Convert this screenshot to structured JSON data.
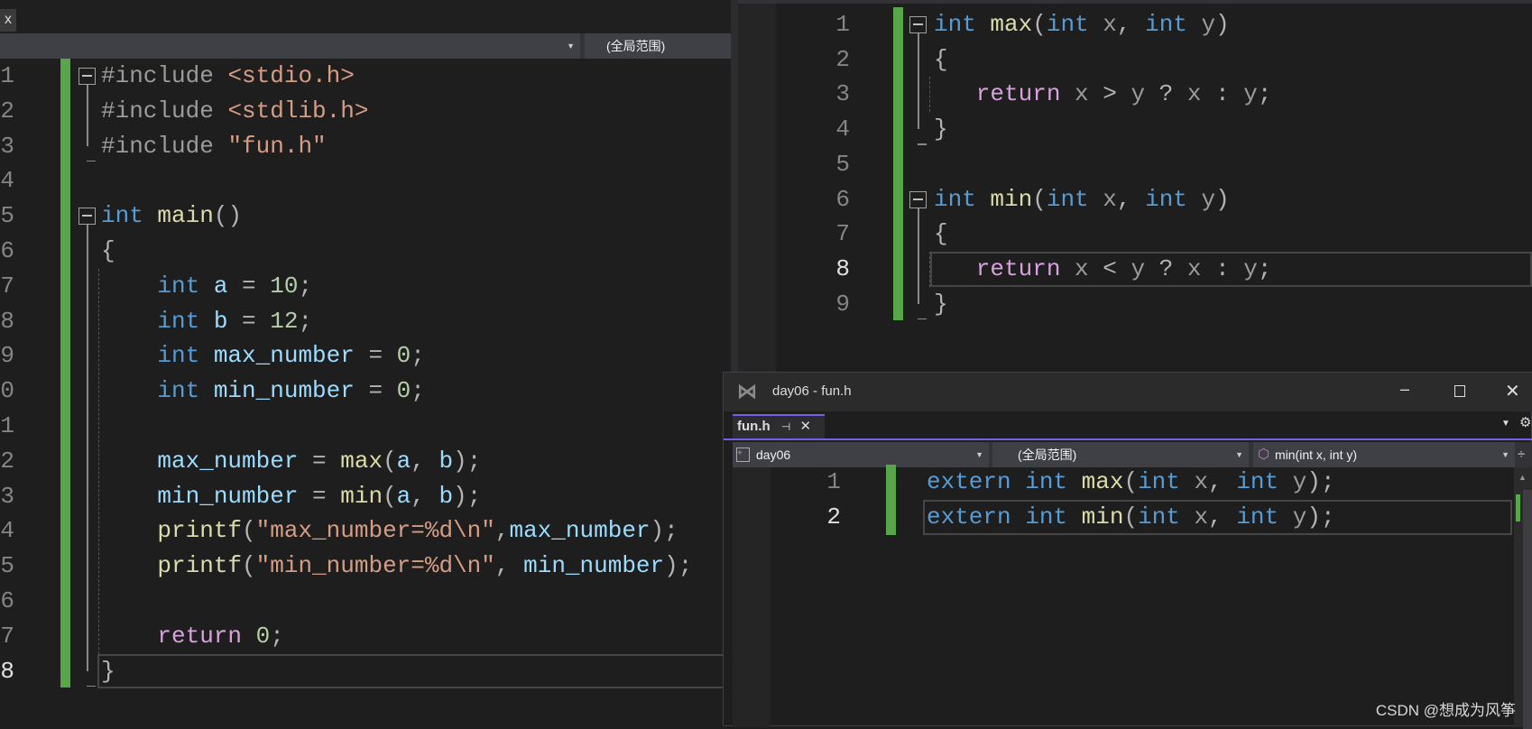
{
  "left": {
    "scope": "(全局范围)",
    "close": "x",
    "lines": [
      [
        [
          "#include ",
          "pp"
        ],
        [
          "<stdio.h>",
          "str"
        ]
      ],
      [
        [
          "#include ",
          "pp"
        ],
        [
          "<stdlib.h>",
          "str"
        ]
      ],
      [
        [
          "#include ",
          "pp"
        ],
        [
          "\"fun.h\"",
          "str"
        ]
      ],
      [],
      [
        [
          "int ",
          "kw"
        ],
        [
          "main",
          "fn"
        ],
        [
          "()",
          "pun"
        ]
      ],
      [
        [
          "{",
          "pun"
        ]
      ],
      [
        [
          "    int ",
          "kw"
        ],
        [
          "a",
          "var"
        ],
        [
          " = ",
          "pun"
        ],
        [
          "10",
          "num"
        ],
        [
          ";",
          "pun"
        ]
      ],
      [
        [
          "    int ",
          "kw"
        ],
        [
          "b",
          "var"
        ],
        [
          " = ",
          "pun"
        ],
        [
          "12",
          "num"
        ],
        [
          ";",
          "pun"
        ]
      ],
      [
        [
          "    int ",
          "kw"
        ],
        [
          "max_number",
          "var"
        ],
        [
          " = ",
          "pun"
        ],
        [
          "0",
          "num"
        ],
        [
          ";",
          "pun"
        ]
      ],
      [
        [
          "    int ",
          "kw"
        ],
        [
          "min_number",
          "var"
        ],
        [
          " = ",
          "pun"
        ],
        [
          "0",
          "num"
        ],
        [
          ";",
          "pun"
        ]
      ],
      [],
      [
        [
          "    max_number",
          "var"
        ],
        [
          " = ",
          "pun"
        ],
        [
          "max",
          "fn"
        ],
        [
          "(",
          "pun"
        ],
        [
          "a",
          "var"
        ],
        [
          ", ",
          "pun"
        ],
        [
          "b",
          "var"
        ],
        [
          ");",
          "pun"
        ]
      ],
      [
        [
          "    min_number",
          "var"
        ],
        [
          " = ",
          "pun"
        ],
        [
          "min",
          "fn"
        ],
        [
          "(",
          "pun"
        ],
        [
          "a",
          "var"
        ],
        [
          ", ",
          "pun"
        ],
        [
          "b",
          "var"
        ],
        [
          ");",
          "pun"
        ]
      ],
      [
        [
          "    printf",
          "fn"
        ],
        [
          "(",
          "pun"
        ],
        [
          "\"max_number=%d\\n\"",
          "str"
        ],
        [
          ",",
          "pun"
        ],
        [
          "max_number",
          "var"
        ],
        [
          ");",
          "pun"
        ]
      ],
      [
        [
          "    printf",
          "fn"
        ],
        [
          "(",
          "pun"
        ],
        [
          "\"min_number=%d\\n\"",
          "str"
        ],
        [
          ", ",
          "pun"
        ],
        [
          "min_number",
          "var"
        ],
        [
          ");",
          "pun"
        ]
      ],
      [],
      [
        [
          "    return ",
          "ctl"
        ],
        [
          "0",
          "num"
        ],
        [
          ";",
          "pun"
        ]
      ],
      [
        [
          "}",
          "pun"
        ]
      ]
    ]
  },
  "right": {
    "lines": [
      [
        [
          "int ",
          "kw"
        ],
        [
          "max",
          "fn"
        ],
        [
          "(",
          "pun"
        ],
        [
          "int ",
          "kw"
        ],
        [
          "x",
          "pp"
        ],
        [
          ", ",
          "pun"
        ],
        [
          "int ",
          "kw"
        ],
        [
          "y",
          "pp"
        ],
        [
          ")",
          "pun"
        ]
      ],
      [
        [
          "{",
          "pun"
        ]
      ],
      [
        [
          "   return ",
          "ctl"
        ],
        [
          "x",
          "pp"
        ],
        [
          " > ",
          "pun"
        ],
        [
          "y",
          "pp"
        ],
        [
          " ? ",
          "pun"
        ],
        [
          "x",
          "pp"
        ],
        [
          " : ",
          "pun"
        ],
        [
          "y",
          "pp"
        ],
        [
          ";",
          "pun"
        ]
      ],
      [
        [
          "}",
          "pun"
        ]
      ],
      [],
      [
        [
          "int ",
          "kw"
        ],
        [
          "min",
          "fn"
        ],
        [
          "(",
          "pun"
        ],
        [
          "int ",
          "kw"
        ],
        [
          "x",
          "pp"
        ],
        [
          ", ",
          "pun"
        ],
        [
          "int ",
          "kw"
        ],
        [
          "y",
          "pp"
        ],
        [
          ")",
          "pun"
        ]
      ],
      [
        [
          "{",
          "pun"
        ]
      ],
      [
        [
          "   return ",
          "ctl"
        ],
        [
          "x",
          "pp"
        ],
        [
          " < ",
          "pun"
        ],
        [
          "y",
          "pp"
        ],
        [
          " ? ",
          "pun"
        ],
        [
          "x",
          "pp"
        ],
        [
          " : ",
          "pun"
        ],
        [
          "y",
          "pp"
        ],
        [
          ";",
          "pun"
        ]
      ],
      [
        [
          "}",
          "pun"
        ]
      ]
    ]
  },
  "float": {
    "title": "day06 - fun.h",
    "tab": "fun.h",
    "project": "day06",
    "scope": "(全局范围)",
    "member": "min(int x, int y)",
    "lines": [
      [
        [
          "extern ",
          "kw"
        ],
        [
          "int ",
          "kw"
        ],
        [
          "max",
          "fn"
        ],
        [
          "(",
          "pun"
        ],
        [
          "int ",
          "kw"
        ],
        [
          "x",
          "pp"
        ],
        [
          ", ",
          "pun"
        ],
        [
          "int ",
          "kw"
        ],
        [
          "y",
          "pp"
        ],
        [
          ");",
          "pun"
        ]
      ],
      [
        [
          "extern ",
          "kw"
        ],
        [
          "int ",
          "kw"
        ],
        [
          "min",
          "fn"
        ],
        [
          "(",
          "pun"
        ],
        [
          "int ",
          "kw"
        ],
        [
          "x",
          "pp"
        ],
        [
          ", ",
          "pun"
        ],
        [
          "int ",
          "kw"
        ],
        [
          "y",
          "pp"
        ],
        [
          ");",
          "pun"
        ]
      ]
    ]
  },
  "watermark": "CSDN @想成为风筝",
  "colors": {
    "accent": "#7160e8",
    "change_bar": "#57a64a",
    "background": "#1e1e1e"
  }
}
